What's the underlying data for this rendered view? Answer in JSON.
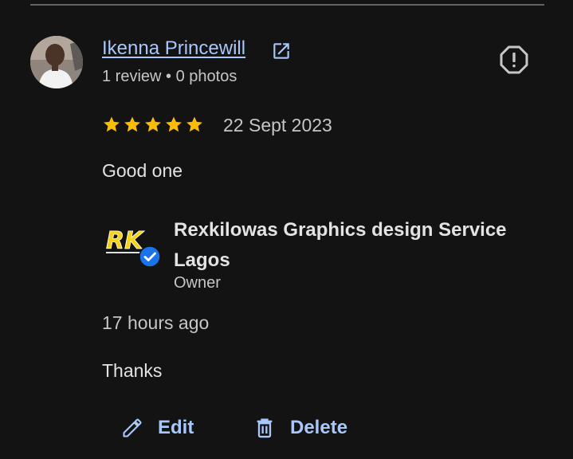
{
  "review": {
    "reviewer_name": "Ikenna Princewill",
    "reviewer_meta": "1 review • 0 photos",
    "rating": 5,
    "date": "22 Sept 2023",
    "text": "Good one"
  },
  "owner_reply": {
    "business_name": "Rexkilowas Graphics design Service Lagos",
    "role": "Owner",
    "logo_text": "RK",
    "time": "17 hours ago",
    "text": "Thanks"
  },
  "actions": {
    "edit_label": "Edit",
    "delete_label": "Delete"
  },
  "icons": {
    "open_profile": "open-in-new-icon",
    "report": "report-icon",
    "star": "star-icon",
    "verified": "verified-badge-icon",
    "edit": "pencil-icon",
    "delete": "trash-icon"
  },
  "colors": {
    "background": "#131314",
    "link": "#a8c7fa",
    "star": "#fbbc04",
    "verified": "#1a73e8",
    "text_primary": "#e3e3e3",
    "text_secondary": "#c4c7c5"
  }
}
